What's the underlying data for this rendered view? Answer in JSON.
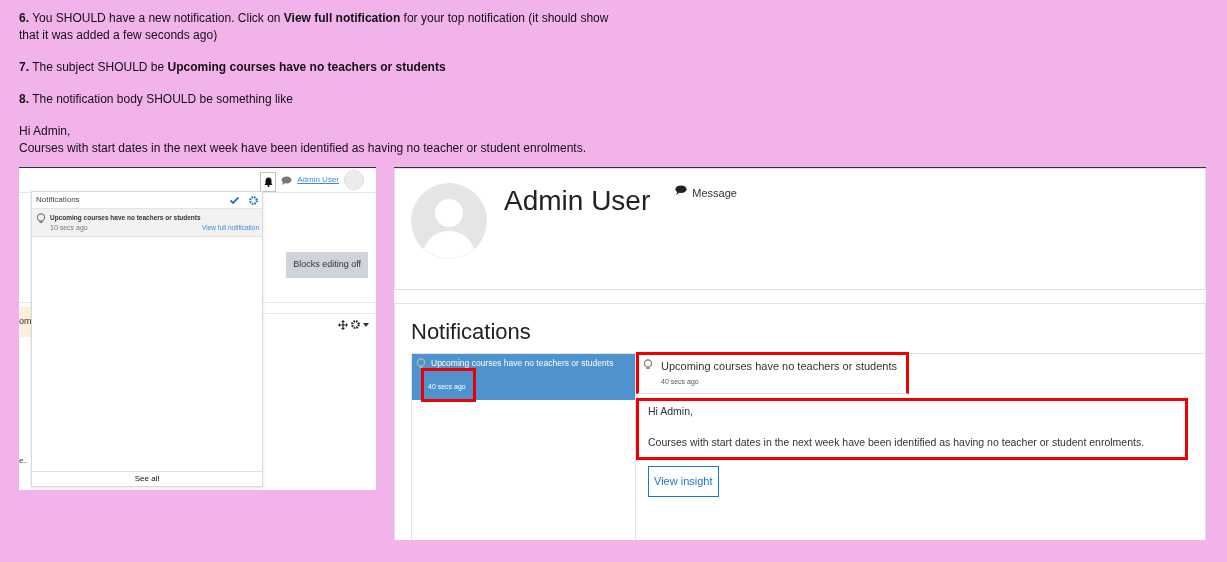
{
  "instructions": [
    {
      "text": "**6.** You SHOULD  have a new notification. Click on **View full notification**  for your top notification (it should show that it was added a few  seconds ago)"
    },
    {
      "text": "**7.** The subject SHOULD be **Upcoming courses have no teachers or students**"
    },
    {
      "text": "**8.** The notification body SHOULD  be something  like"
    }
  ],
  "example_body": {
    "greeting": "Hi Admin,",
    "body": "Courses with start dates in the next week  have been  identified as having no teacher or student enrolments."
  },
  "left_screenshot": {
    "navbar": {
      "user_name": "Admin User"
    },
    "blocks_button": "Blocks editing off",
    "cut_texts": [
      "om",
      "e.."
    ],
    "popover": {
      "title": "Notifications",
      "items": [
        {
          "title": "Upcoming courses have no teachers or students",
          "time": "10 secs ago",
          "link": "View full notification"
        }
      ],
      "footer": "See all"
    }
  },
  "right_screenshot": {
    "profile": {
      "name": "Admin User",
      "message_link": "Message"
    },
    "notifications": {
      "heading": "Notifications",
      "list": [
        {
          "title": "Upcoming courses have no teachers or students",
          "time": "40 secs ago",
          "selected": true,
          "time_highlighted": true
        }
      ],
      "detail": {
        "title": "Upcoming courses have no teachers or students",
        "time": "40 secs ago",
        "header_highlighted": true,
        "greeting": "Hi Admin,",
        "body": "Courses with start dates in the next week have been identified as having no teacher or student enrolments.",
        "body_highlighted": true,
        "action": "View insight"
      }
    }
  }
}
